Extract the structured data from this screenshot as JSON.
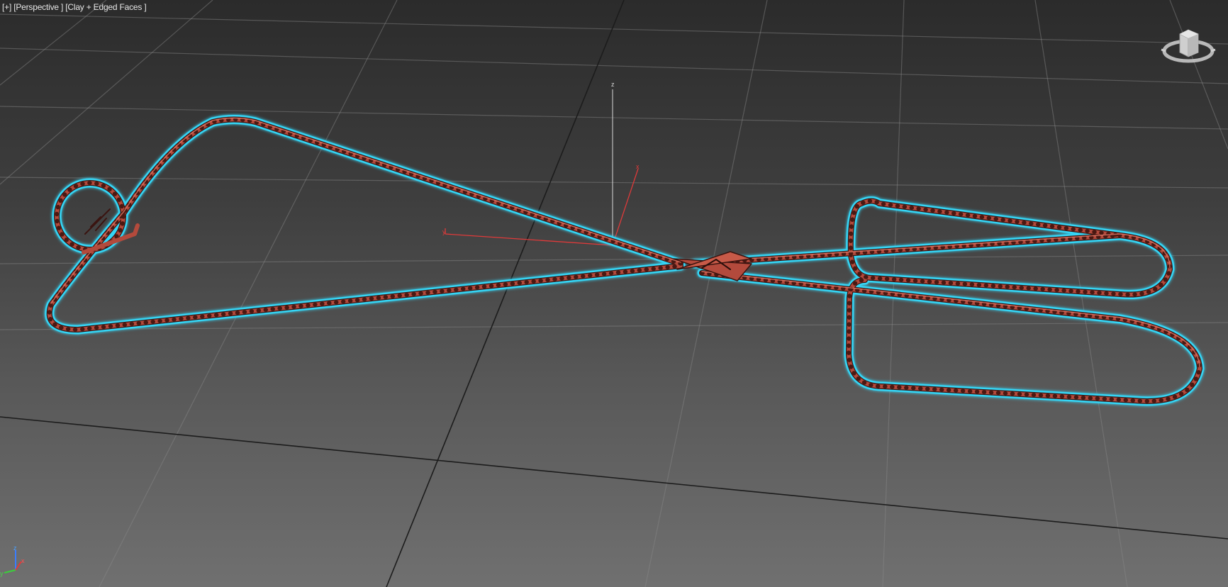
{
  "viewport": {
    "menu_label": "[+]",
    "view_label": "[Perspective ]",
    "shading_label": "[Clay + Edged Faces ]"
  },
  "gizmo": {
    "x_axis_label": "x",
    "y_axis_label": "y",
    "z_axis_label": "z"
  },
  "tripod": {
    "x_label": "x",
    "y_label": "y",
    "z_label": "z"
  },
  "colors": {
    "selection_outline": "#34d5f5",
    "wire_fill": "#b34a3c",
    "wire_highlight": "#e27a68",
    "grid_line": "#8a8a8a",
    "grid_axis": "#1a1a1a",
    "gizmo_x": "#e03a3a",
    "gizmo_z": "#d8d8d8"
  },
  "icons": {
    "viewcube": "viewcube-icon",
    "tripod": "axis-tripod-icon"
  }
}
